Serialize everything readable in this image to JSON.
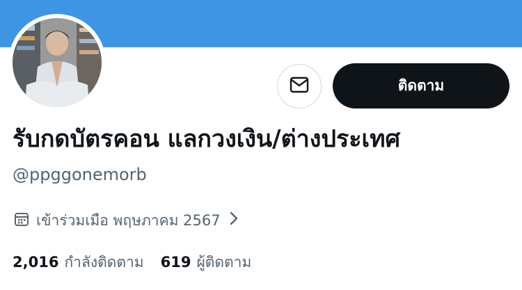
{
  "profile": {
    "display_name": "รับกดบัตรคอน แลกวงเงิน/ต่างประเทศ",
    "handle": "@ppggonemorb",
    "joined": "เข้าร่วมเมือ พฤษภาคม 2567",
    "following_count": "2,016",
    "following_label": "กำลังติดตาม",
    "followers_count": "619",
    "followers_label": "ผู้ติดตาม"
  },
  "actions": {
    "follow_label": "ติดตาม"
  },
  "icons": {
    "message": "envelope-icon",
    "calendar": "calendar-icon",
    "chevron": "chevron-right-icon"
  },
  "colors": {
    "banner": "#3e95e4",
    "follow_button": "#0f1419",
    "secondary_text": "#536471"
  }
}
